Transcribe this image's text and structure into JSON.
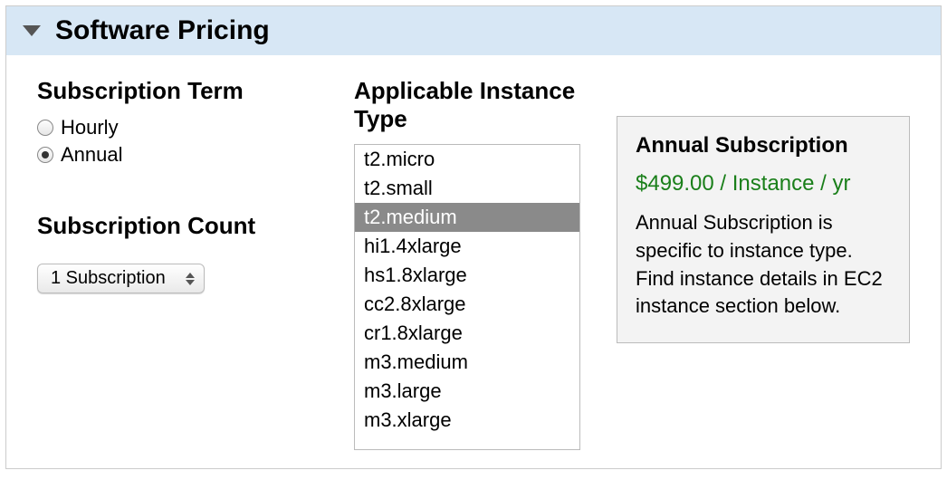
{
  "header": {
    "title": "Software Pricing"
  },
  "term": {
    "heading": "Subscription Term",
    "options": [
      {
        "label": "Hourly",
        "checked": false
      },
      {
        "label": "Annual",
        "checked": true
      }
    ]
  },
  "count": {
    "heading": "Subscription Count",
    "selected": "1 Subscription"
  },
  "instance": {
    "heading": "Applicable Instance Type",
    "options": [
      {
        "label": "t2.micro"
      },
      {
        "label": "t2.small"
      },
      {
        "label": "t2.medium",
        "selected": true
      },
      {
        "label": "hi1.4xlarge"
      },
      {
        "label": "hs1.8xlarge"
      },
      {
        "label": "cc2.8xlarge"
      },
      {
        "label": "cr1.8xlarge"
      },
      {
        "label": "m3.medium"
      },
      {
        "label": "m3.large"
      },
      {
        "label": "m3.xlarge"
      }
    ]
  },
  "info": {
    "title": "Annual Subscription",
    "price": "$499.00 / Instance / yr",
    "description": "Annual Subscription is specific to instance type. Find instance details in EC2 instance section below."
  }
}
